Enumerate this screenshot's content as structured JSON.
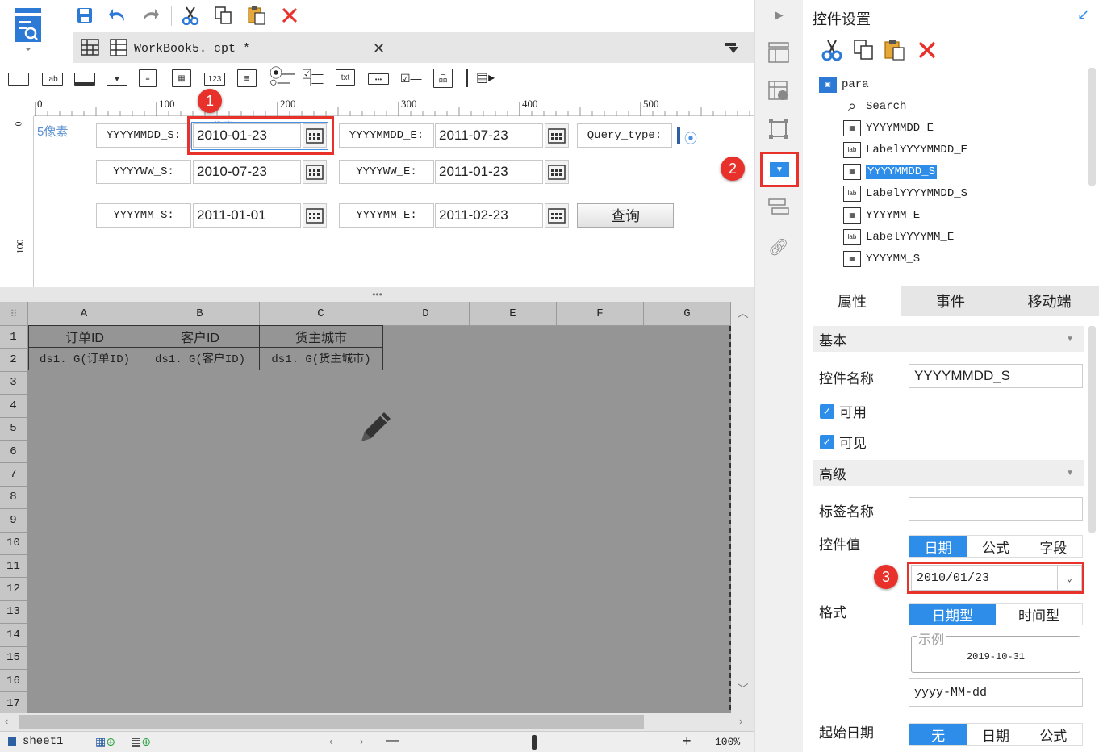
{
  "tab": {
    "title": "WorkBook5. cpt *"
  },
  "ruler": {
    "marks": [
      "0",
      "100",
      "200",
      "300",
      "400",
      "500"
    ],
    "vmarks": [
      "0",
      "100"
    ]
  },
  "canvas": {
    "margin_label": "5像素",
    "hint_label": "100像素",
    "rows": [
      {
        "label_s": "YYYYMMDD_S:",
        "value_s": "2010-01-23",
        "label_e": "YYYYMMDD_E:",
        "value_e": "2011-07-23"
      },
      {
        "label_s": "YYYYWW_S:",
        "value_s": "2010-07-23",
        "label_e": "YYYYWW_E:",
        "value_e": "2011-01-23"
      },
      {
        "label_s": "YYYYMM_S:",
        "value_s": "2011-01-01",
        "label_e": "YYYYMM_E:",
        "value_e": "2011-02-23"
      }
    ],
    "query_type_label": "Query_type:",
    "query_button": "查询"
  },
  "badges": [
    "1",
    "2",
    "3"
  ],
  "grid": {
    "columns": [
      "A",
      "B",
      "C",
      "D",
      "E",
      "F",
      "G"
    ],
    "rows": [
      "1",
      "2",
      "3",
      "4",
      "5",
      "6",
      "7",
      "8",
      "9",
      "10",
      "11",
      "12",
      "13",
      "14",
      "15",
      "16",
      "17"
    ],
    "headers": [
      "订单ID",
      "客户ID",
      "货主城市"
    ],
    "data": [
      "ds1. G(订单ID)",
      "ds1. G(客户ID)",
      "ds1. G(货主城市)"
    ]
  },
  "status": {
    "sheet": "sheet1",
    "zoom": "100%"
  },
  "panel": {
    "title": "控件设置",
    "tree": [
      {
        "label": "para",
        "icon": "form-icon",
        "indent": 0
      },
      {
        "label": "Search",
        "icon": "search-icon",
        "indent": 1
      },
      {
        "label": "YYYYMMDD_E",
        "icon": "calendar-icon",
        "indent": 1
      },
      {
        "label": "LabelYYYYMMDD_E",
        "icon": "label-icon",
        "indent": 1
      },
      {
        "label": "YYYYMMDD_S",
        "icon": "calendar-icon",
        "indent": 1,
        "selected": true
      },
      {
        "label": "LabelYYYYMMDD_S",
        "icon": "label-icon",
        "indent": 1
      },
      {
        "label": "YYYYMM_E",
        "icon": "calendar-icon",
        "indent": 1
      },
      {
        "label": "LabelYYYYMM_E",
        "icon": "label-icon",
        "indent": 1
      },
      {
        "label": "YYYYMM_S",
        "icon": "calendar-icon",
        "indent": 1
      }
    ],
    "tabs": [
      "属性",
      "事件",
      "移动端"
    ],
    "basic_section": "基本",
    "name_label": "控件名称",
    "name_value": "YYYYMMDD_S",
    "enabled_label": "可用",
    "visible_label": "可见",
    "advanced_section": "高级",
    "tag_label": "标签名称",
    "value_label": "控件值",
    "value_modes": [
      "日期",
      "公式",
      "字段"
    ],
    "value_date": "2010/01/23",
    "format_label": "格式",
    "format_modes": [
      "日期型",
      "时间型"
    ],
    "example_legend": "示例",
    "example_value": "2019-10-31",
    "format_value": "yyyy-MM-dd",
    "start_label": "起始日期",
    "start_modes": [
      "无",
      "日期",
      "公式"
    ]
  },
  "colors": {
    "accent": "#2d8de8",
    "badge": "#e8312a",
    "grid": "#959595"
  }
}
